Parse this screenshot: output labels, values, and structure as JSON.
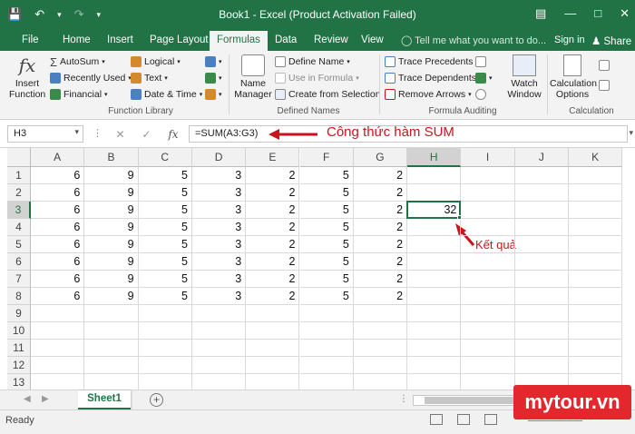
{
  "title_bar": {
    "title": "Book1 - Excel (Product Activation Failed)"
  },
  "tabs": {
    "file": "File",
    "home": "Home",
    "insert": "Insert",
    "page_layout": "Page Layout",
    "formulas": "Formulas",
    "data": "Data",
    "review": "Review",
    "view": "View",
    "tell_me": "Tell me what you want to do...",
    "sign_in": "Sign in",
    "share": "Share"
  },
  "ribbon": {
    "insert_function": "Insert Function",
    "autosum": "AutoSum",
    "recently_used": "Recently Used",
    "financial": "Financial",
    "logical": "Logical",
    "text": "Text",
    "date_time": "Date & Time",
    "function_library": "Function Library",
    "name_manager": "Name Manager",
    "define_name": "Define Name",
    "use_in_formula": "Use in Formula",
    "create_from_selection": "Create from Selection",
    "defined_names": "Defined Names",
    "trace_precedents": "Trace Precedents",
    "trace_dependents": "Trace Dependents",
    "remove_arrows": "Remove Arrows",
    "formula_auditing": "Formula Auditing",
    "watch_window": "Watch Window",
    "calculation_options": "Calculation Options",
    "calculation": "Calculation"
  },
  "formula_bar": {
    "name_box": "H3",
    "formula": "=SUM(A3:G3)",
    "fx": "fx"
  },
  "sheet": {
    "columns": [
      "A",
      "B",
      "C",
      "D",
      "E",
      "F",
      "G",
      "H",
      "I",
      "J",
      "K"
    ],
    "rows": [
      "1",
      "2",
      "3",
      "4",
      "5",
      "6",
      "7",
      "8",
      "9",
      "10",
      "11",
      "12",
      "13"
    ],
    "data": [
      [
        "6",
        "9",
        "5",
        "3",
        "2",
        "5",
        "2"
      ],
      [
        "6",
        "9",
        "5",
        "3",
        "2",
        "5",
        "2"
      ],
      [
        "6",
        "9",
        "5",
        "3",
        "2",
        "5",
        "2"
      ],
      [
        "6",
        "9",
        "5",
        "3",
        "2",
        "5",
        "2"
      ],
      [
        "6",
        "9",
        "5",
        "3",
        "2",
        "5",
        "2"
      ],
      [
        "6",
        "9",
        "5",
        "3",
        "2",
        "5",
        "2"
      ],
      [
        "6",
        "9",
        "5",
        "3",
        "2",
        "5",
        "2"
      ],
      [
        "6",
        "9",
        "5",
        "3",
        "2",
        "5",
        "2"
      ]
    ],
    "result_value": "32",
    "active_cell": "H3"
  },
  "annotations": {
    "formula_note": "Công thức hàm SUM",
    "result_note": "Kết quả",
    "color": "#c8151d"
  },
  "sheet_tab": {
    "name": "Sheet1"
  },
  "status": {
    "text": "Ready"
  },
  "watermark": {
    "text": "mytour.vn"
  },
  "colors": {
    "excel_green": "#217346"
  }
}
